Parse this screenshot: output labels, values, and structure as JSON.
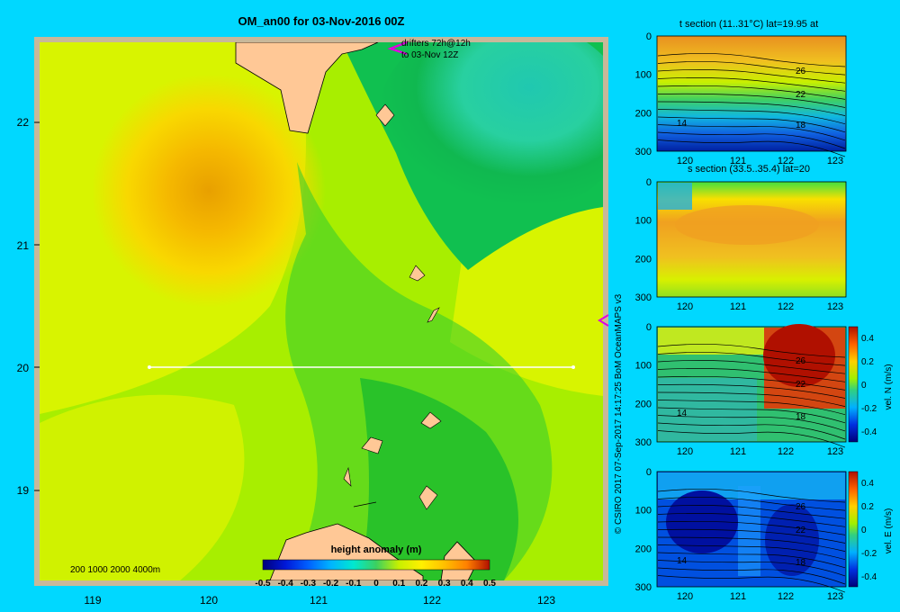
{
  "main_map": {
    "title": "OM_an00 for 03-Nov-2016 00Z",
    "drifter_note_line1": "drifters 72h@12h",
    "drifter_note_line2": "to 03-Nov 12Z",
    "lat_ticks": [
      "22",
      "21",
      "20",
      "19"
    ],
    "lon_ticks": [
      "119",
      "120",
      "121",
      "122",
      "123"
    ],
    "depth_legend": "200  1000  2000  4000m",
    "colorbar_title": "height anomaly (m)",
    "colorbar_ticks": [
      "-0.5",
      "-0.4",
      "-0.3",
      "-0.2",
      "-0.1",
      "0",
      "0.1",
      "0.2",
      "0.3",
      "0.4",
      "0.5"
    ],
    "colorbar_colors": [
      "#00007a",
      "#0018d8",
      "#0060ff",
      "#00b4ff",
      "#00e8d0",
      "#3cd060",
      "#60e020",
      "#c8f000",
      "#fff000",
      "#ffc000",
      "#ff8000",
      "#e84000",
      "#b01000"
    ],
    "section_line_lat": 20
  },
  "credit": "© CSIRO 2017   07-Sep-2017 14:17:25 BoM OceanMAPS v3",
  "panels": [
    {
      "title": "t section (11..31°C) lat=19.95 at",
      "y_ticks": [
        "0",
        "100",
        "200",
        "300"
      ],
      "x_ticks": [
        "120",
        "121",
        "122",
        "123"
      ],
      "contour_labels": [
        "26",
        "22",
        "18",
        "14"
      ]
    },
    {
      "title": "s section (33.5..35.4) lat=20",
      "y_ticks": [
        "0",
        "100",
        "200",
        "300"
      ],
      "x_ticks": [
        "120",
        "121",
        "122",
        "123"
      ]
    },
    {
      "title": "",
      "y_ticks": [
        "0",
        "100",
        "200",
        "300"
      ],
      "x_ticks": [
        "120",
        "121",
        "122",
        "123"
      ],
      "contour_labels": [
        "26",
        "22",
        "18",
        "14"
      ],
      "colorbar_ticks": [
        "0.4",
        "0.2",
        "0",
        "-0.2",
        "-0.4"
      ],
      "colorbar_label": "vel. N (m/s)"
    },
    {
      "title": "",
      "y_ticks": [
        "0",
        "100",
        "200",
        "300"
      ],
      "x_ticks": [
        "120",
        "121",
        "122",
        "123"
      ],
      "contour_labels": [
        "26",
        "22",
        "18",
        "14"
      ],
      "colorbar_ticks": [
        "0.4",
        "0.2",
        "0",
        "-0.2",
        "-0.4"
      ],
      "colorbar_label": "vel. E (m/s)"
    }
  ]
}
